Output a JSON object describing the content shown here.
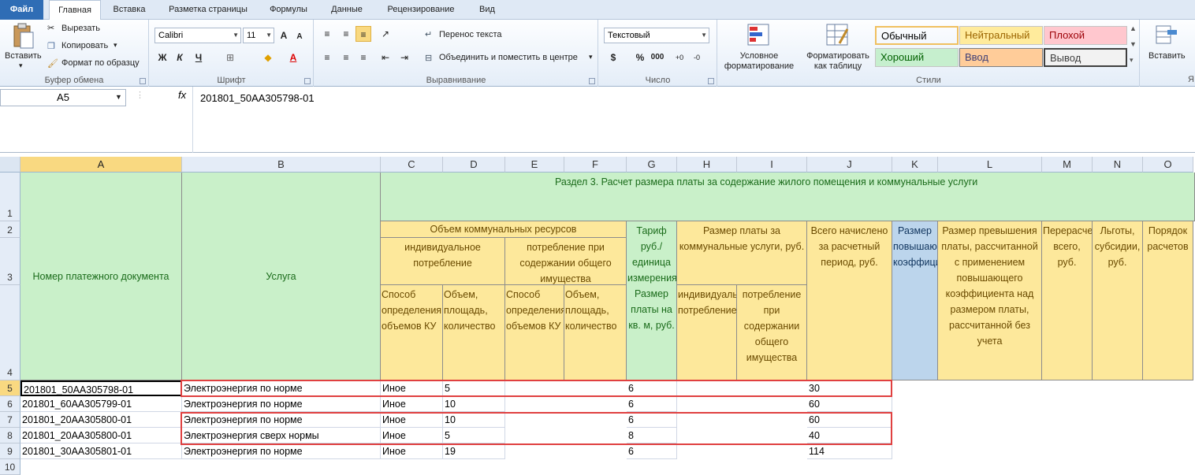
{
  "tabs": [
    "Файл",
    "Главная",
    "Вставка",
    "Разметка страницы",
    "Формулы",
    "Данные",
    "Рецензирование",
    "Вид"
  ],
  "active_tab": "Главная",
  "clipboard": {
    "paste": "Вставить",
    "cut": "Вырезать",
    "copy": "Копировать",
    "format_painter": "Формат по образцу",
    "label": "Буфер обмена"
  },
  "font": {
    "name": "Calibri",
    "size": "11",
    "bold": "Ж",
    "italic": "К",
    "underline": "Ч",
    "label": "Шрифт",
    "grow": "A",
    "shrink": "A"
  },
  "alignment": {
    "wrap": "Перенос текста",
    "merge": "Объединить и поместить в центре",
    "label": "Выравнивание"
  },
  "number": {
    "format": "Текстовый",
    "currency": "$",
    "percent": "%",
    "thousands": "000",
    "label": "Число"
  },
  "styles_group": {
    "conditional": "Условное форматирование",
    "table": "Форматировать как таблицу",
    "label": "Стили",
    "cells": [
      {
        "name": "Обычный",
        "bg": "#ffffff",
        "fg": "#000000"
      },
      {
        "name": "Нейтральный",
        "bg": "#ffeb9c",
        "fg": "#9c6500"
      },
      {
        "name": "Плохой",
        "bg": "#ffc7ce",
        "fg": "#9c0006"
      },
      {
        "name": "Хороший",
        "bg": "#c6efce",
        "fg": "#006100"
      },
      {
        "name": "Ввод",
        "bg": "#ffcc99",
        "fg": "#3f3f76"
      },
      {
        "name": "Вывод",
        "bg": "#f2f2f2",
        "fg": "#3f3f3f"
      }
    ]
  },
  "insert_group": {
    "insert": "Вставить",
    "label_partial": "Я"
  },
  "formula_bar": {
    "name_box": "A5",
    "fx": "fx",
    "value": "201801_50AA305798-01"
  },
  "columns": [
    "A",
    "B",
    "C",
    "D",
    "E",
    "F",
    "G",
    "H",
    "I",
    "J",
    "K",
    "L",
    "M",
    "N",
    "O"
  ],
  "rows": [
    "1",
    "2",
    "3",
    "4",
    "5",
    "6",
    "7",
    "8",
    "9",
    "10"
  ],
  "header": {
    "section": "Раздел 3. Расчет размера платы за содержание жилого помещения и коммунальные услуги",
    "doc_number": "Номер платежного документа",
    "service": "Услуга",
    "volume": "Объем коммунальных ресурсов",
    "individual": "индивидуальное потребление",
    "common": "потребление при содержании общего имущества",
    "method1": "Способ определения объемов КУ",
    "amount1": "Объем, площадь, количество",
    "method2": "Способ определения объемов КУ",
    "amount2": "Объем, площадь, количество",
    "tariff": "Тариф руб./единица измерения Размер платы на кв. м, руб.",
    "payment": "Размер платы за коммунальные услуги, руб.",
    "pay_individual": "индивидуальное потребление",
    "pay_common": "потребление при содержании общего имущества",
    "total": "Всего начислено за расчетный период, руб.",
    "coef": "Размер повышающего коэффициента",
    "excess": "Размер превышения платы, рассчитанной с применением повышающего коэффициента над размером платы, рассчитанной без учета",
    "recalc": "Перерасчеты всего, руб.",
    "benefits": "Льготы, субсидии, руб.",
    "order": "Порядок расчетов"
  },
  "data_rows": [
    {
      "a": "201801_50AA305798-01",
      "b": "Электроэнергия по норме",
      "c": "Иное",
      "d": "5",
      "g": "6",
      "j": "30"
    },
    {
      "a": "201801_60AA305799-01",
      "b": "Электроэнергия по норме",
      "c": "Иное",
      "d": "10",
      "g": "6",
      "j": "60"
    },
    {
      "a": "201801_20AA305800-01",
      "b": "Электроэнергия по норме",
      "c": "Иное",
      "d": "10",
      "g": "6",
      "j": "60"
    },
    {
      "a": "201801_20AA305800-01",
      "b": "Электроэнергия сверх нормы",
      "c": "Иное",
      "d": "5",
      "g": "8",
      "j": "40"
    },
    {
      "a": "201801_30AA305801-01",
      "b": "Электроэнергия по норме",
      "c": "Иное",
      "d": "19",
      "g": "6",
      "j": "114"
    }
  ]
}
